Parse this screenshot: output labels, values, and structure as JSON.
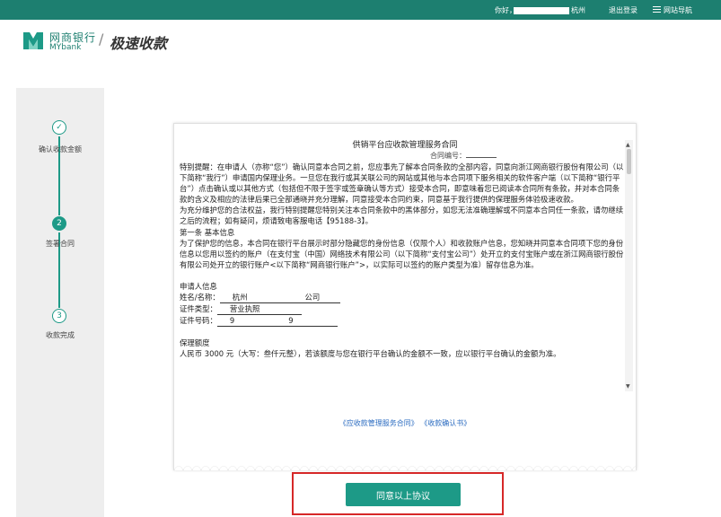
{
  "topbar": {
    "greeting": "你好，",
    "greeting_tail": "杭州",
    "logout": "退出登录",
    "site_nav": "网站导航",
    "menu_icon": "hamburger-icon"
  },
  "header": {
    "logo_cn": "网商银行",
    "logo_en": "MYbank",
    "separator": "/",
    "page_title": "极速收款"
  },
  "steps": [
    {
      "index": "✓",
      "label": "确认收款金额",
      "state": "done"
    },
    {
      "index": "2",
      "label": "签署合同",
      "state": "active"
    },
    {
      "index": "3",
      "label": "收款完成",
      "state": "pending"
    }
  ],
  "contract": {
    "title": "供销平台应收款管理服务合同",
    "number_label": "合同编号：",
    "paragraphs": [
      "特别提醒：在申请人（亦称“您”）确认同意本合同之前，您应事先了解本合同条款的全部内容，同意向浙江网商银行股份有限公司（以下简称“我行”）申请国内保理业务。一旦您在我行或其关联公司的网站或其他与本合同项下服务相关的软件客户端（以下简称“银行平台”）点击确认或以其他方式（包括但不限于签字或签章确认等方式）接受本合同，即意味着您已阅读本合同所有条款，并对本合同条款的含义及相应的法律后果已全部通晓并充分理解，同意接受本合同约束，同意基于我行提供的保理服务体验极速收款。",
      "为充分维护您的合法权益，我行特别提醒您特别关注本合同条款中的黑体部分，如您无法准确理解或不同意本合同任一条款，请勿继续之后的流程；如有疑问，烦请致电客服电话【95188-3】。",
      "第一条 基本信息",
      "为了保护您的信息，本合同在银行平台展示时部分隐藏您的身份信息（仅限个人）和收款账户信息，您知晓并同意本合同项下您的身份信息以您用以签约的账户（在支付宝（中国）网络技术有限公司（以下简称“支付宝公司”）处开立的支付宝账户或在浙江网商银行股份有限公司处开立的银行账户<以下简称“网商银行账户”>，以实际可以签约的账户类型为准）留存信息为准。"
    ],
    "applicant_heading": "申请人信息",
    "name_label": "姓名/名称：",
    "name_value": "杭州",
    "name_suffix": "公司",
    "id_type_label": "证件类型：",
    "id_type_value": "营业执照",
    "id_no_label": "证件号码：",
    "id_no_value": "9",
    "id_no_tail": "9",
    "factoring_heading": "保理额度",
    "factoring_line": "人民币 3000 元（大写：叁仟元整），若该额度与您在银行平台确认的金额不一致，应以银行平台确认的金额为准。",
    "link1": "《应收款管理服务合同》",
    "link2": "《收款确认书》"
  },
  "agree_button": "同意以上协议",
  "colors": {
    "topbar": "#1d7f70",
    "accent": "#1d9a87",
    "link": "#2a6bc0",
    "highlight": "#d62828"
  }
}
